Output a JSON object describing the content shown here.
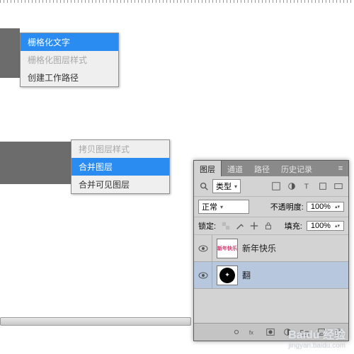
{
  "menu1": {
    "rasterize_text": "栅格化文字",
    "rasterize_style": "栅格化图层样式",
    "create_work_path": "创建工作路径"
  },
  "menu2": {
    "truncated": "拷贝图层样式",
    "merge_layers": "合并图层",
    "merge_visible": "合并可见图层"
  },
  "panel": {
    "tabs": {
      "layers": "图层",
      "channels": "通道",
      "paths": "路径",
      "history": "历史记录"
    },
    "kind_label": "类型",
    "blend_mode": "正常",
    "opacity_label": "不透明度:",
    "opacity_value": "100%",
    "lock_label": "锁定:",
    "fill_label": "填充:",
    "fill_value": "100%",
    "layers_list": [
      {
        "name": "新年快乐",
        "thumb": "新年快乐"
      },
      {
        "name": "翻",
        "thumb": "●"
      }
    ]
  },
  "watermark": {
    "brand": "Baidú 经验",
    "url": "jingyan.baidu.com"
  }
}
